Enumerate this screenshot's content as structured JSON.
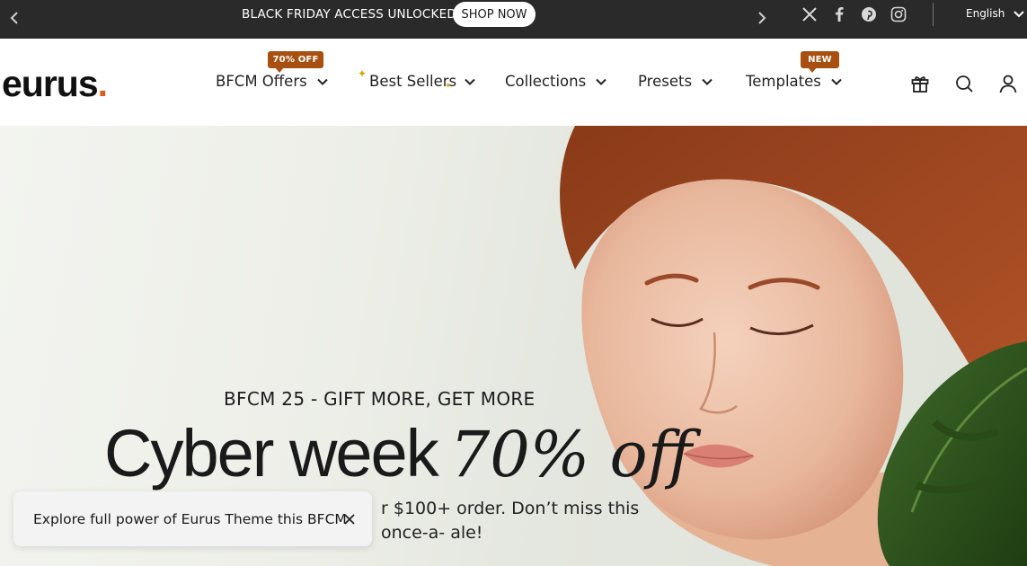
{
  "announcement": {
    "text": "BLACK FRIDAY ACCESS UNLOCKED",
    "cta": "SHOP NOW",
    "language": "English",
    "social_icons": [
      "x-icon",
      "facebook-icon",
      "pinterest-icon",
      "instagram-icon"
    ]
  },
  "header": {
    "logo_text": "eurus",
    "logo_dot": ".",
    "nav": [
      {
        "label": "BFCM Offers",
        "badge": "70% OFF"
      },
      {
        "label": "Best Sellers"
      },
      {
        "label": "Collections"
      },
      {
        "label": "Presets"
      },
      {
        "label": "Templates",
        "badge": "NEW"
      }
    ],
    "icons": [
      "gift-icon",
      "search-icon",
      "account-icon"
    ]
  },
  "hero": {
    "eyebrow": "BFCM 25 - GIFT MORE, GET MORE",
    "headline": "Cyber week",
    "headline_script": "70% off",
    "description": "r $100+ order. Don’t miss this once-a- ale!"
  },
  "toast": {
    "message": "Explore full power of Eurus Theme this BFCM"
  },
  "colors": {
    "topbar_bg": "#2a2a2a",
    "badge": "#a85010",
    "logo_dot": "#d95c19"
  }
}
